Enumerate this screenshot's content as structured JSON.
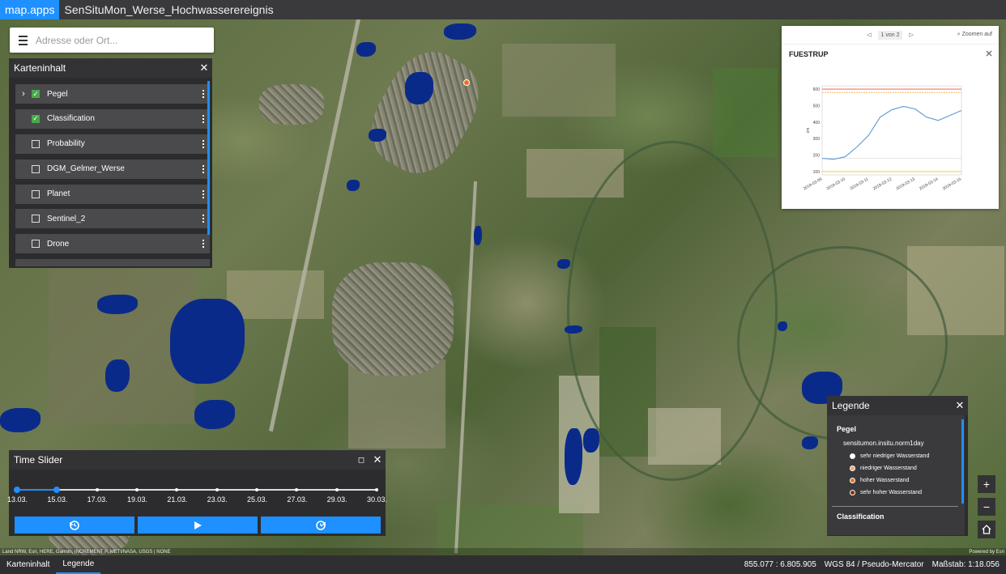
{
  "topbar": {
    "brand": "map.apps",
    "title": "SenSituMon_Werse_Hochwasserereignis"
  },
  "search": {
    "placeholder": "Adresse oder Ort..."
  },
  "karteninhalt": {
    "title": "Karteninhalt",
    "layers": [
      {
        "label": "Pegel",
        "checked": true,
        "expandable": true
      },
      {
        "label": "Classification",
        "checked": true,
        "expandable": false
      },
      {
        "label": "Probability",
        "checked": false,
        "expandable": false
      },
      {
        "label": "DGM_Gelmer_Werse",
        "checked": false,
        "expandable": false
      },
      {
        "label": "Planet",
        "checked": false,
        "expandable": false
      },
      {
        "label": "Sentinel_2",
        "checked": false,
        "expandable": false
      },
      {
        "label": "Drone",
        "checked": false,
        "expandable": false
      }
    ]
  },
  "popup": {
    "pager": "1 von 2",
    "zoom_label": "Zoomen auf",
    "station": "FUESTRUP"
  },
  "chart_data": {
    "type": "line",
    "title": "",
    "xlabel": "",
    "ylabel": "cm",
    "x": [
      "2019-03-09",
      "2019-03-10",
      "2019-03-11",
      "2019-03-12",
      "2019-03-13",
      "2019-03-14",
      "2019-03-15"
    ],
    "x_ticks": [
      "2019-03-09",
      "2019-03-10",
      "2019-03-11",
      "2019-03-12",
      "2019-03-13",
      "2019-03-14",
      "2019-03-15"
    ],
    "y_ticks": [
      100,
      200,
      300,
      400,
      500,
      600
    ],
    "ylim": [
      80,
      620
    ],
    "series": [
      {
        "points": [
          [
            0,
            180
          ],
          [
            0.5,
            175
          ],
          [
            1,
            190
          ],
          [
            1.5,
            250
          ],
          [
            2,
            320
          ],
          [
            2.5,
            430
          ],
          [
            3,
            475
          ],
          [
            3.5,
            495
          ],
          [
            4,
            480
          ],
          [
            4.5,
            430
          ],
          [
            5,
            410
          ],
          [
            5.5,
            440
          ],
          [
            6,
            470
          ]
        ],
        "color": "#5b9bd5"
      }
    ],
    "thresholds": [
      {
        "value": 600,
        "color": "#e74c3c"
      },
      {
        "value": 580,
        "color": "#f39c12"
      },
      {
        "value": 180,
        "color": "#dddddd"
      },
      {
        "value": 100,
        "color": "#f1c40f"
      }
    ],
    "grid": false
  },
  "legend": {
    "title": "Legende",
    "group": "Pegel",
    "source": "sensitumon.insitu.norm1day",
    "items": [
      {
        "label": "sehr niedriger Wasserstand",
        "color": "#ffffff"
      },
      {
        "label": "niedriger Wasserstand",
        "color": "#f5a66b"
      },
      {
        "label": "hoher Wasserstand",
        "color": "#e8701a"
      },
      {
        "label": "sehr hoher Wasserstand",
        "color": "#8b2c0c"
      }
    ],
    "group2": "Classification"
  },
  "timeslider": {
    "title": "Time Slider",
    "labels": [
      "13.03.",
      "15.03.",
      "17.03.",
      "19.03.",
      "21.03.",
      "23.03.",
      "25.03.",
      "27.03.",
      "29.03.",
      "30.03."
    ],
    "range_start": "13.03.",
    "range_end": "15.03."
  },
  "attribution": {
    "text": "Land NRW, Esri, HERE, Garmin, INCREMENT P, METI/NASA, USGS | NONE",
    "powered": "Powered by Esri"
  },
  "statusbar": {
    "tabs": [
      "Karteninhalt",
      "Legende"
    ],
    "active_tab": "Legende",
    "coords": "855.077 : 6.805.905",
    "crs": "WGS 84 / Pseudo-Mercator",
    "scale": "Maßstab: 1:18.056"
  },
  "colors": {
    "accent": "#1e90ff",
    "panel": "#333336",
    "water": "#0a2a8a"
  }
}
